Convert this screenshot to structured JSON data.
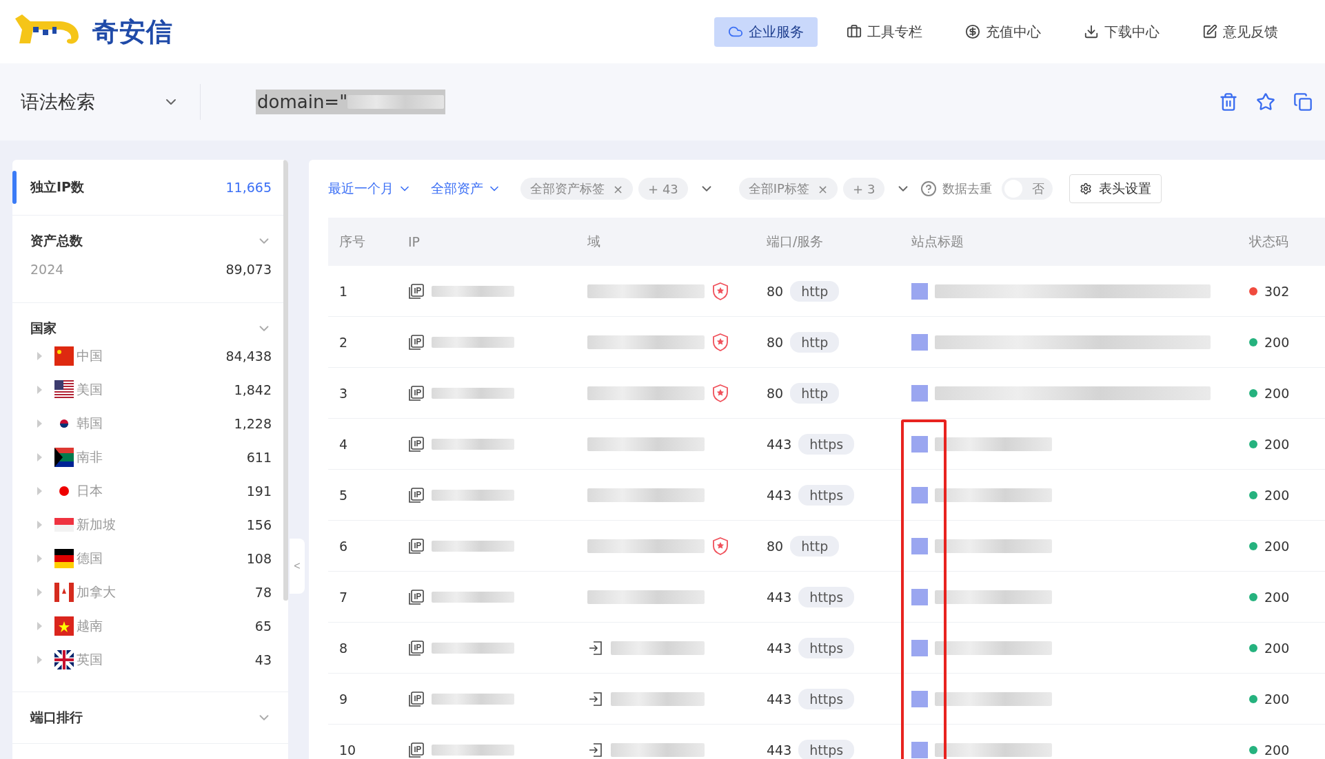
{
  "header": {
    "logo_text": "奇安信",
    "nav": [
      {
        "label": "企业服务",
        "selected": true
      },
      {
        "label": "工具专栏",
        "selected": false
      },
      {
        "label": "充值中心",
        "selected": false
      },
      {
        "label": "下载中心",
        "selected": false
      },
      {
        "label": "意见反馈",
        "selected": false
      }
    ]
  },
  "search": {
    "mode": "语法检索",
    "query": "domain=\""
  },
  "sidebar": {
    "sections": [
      {
        "kind": "single",
        "title": "独立IP数",
        "value": "11,665",
        "selected": true
      },
      {
        "kind": "list",
        "title": "资产总数",
        "expanded": true,
        "items": [
          {
            "label": "2024",
            "value": "89,073"
          }
        ]
      },
      {
        "kind": "countries",
        "title": "国家",
        "expanded": true,
        "items": [
          {
            "label": "中国",
            "value": "84,438",
            "kind": "cn"
          },
          {
            "label": "美国",
            "value": "1,842",
            "kind": "us"
          },
          {
            "label": "韩国",
            "value": "1,228",
            "kind": "kr"
          },
          {
            "label": "南非",
            "value": "611",
            "kind": "za"
          },
          {
            "label": "日本",
            "value": "191",
            "kind": "jp"
          },
          {
            "label": "新加坡",
            "value": "156",
            "kind": "sg"
          },
          {
            "label": "德国",
            "value": "108",
            "kind": "de"
          },
          {
            "label": "加拿大",
            "value": "78",
            "kind": "ca"
          },
          {
            "label": "越南",
            "value": "65",
            "kind": "vn"
          },
          {
            "label": "英国",
            "value": "43",
            "kind": "gb"
          }
        ]
      },
      {
        "kind": "list",
        "title": "端口排行",
        "expanded": true
      }
    ]
  },
  "collapse_handle": "<",
  "filters": {
    "time": "最近一个月",
    "assets": "全部资产",
    "asset_tag": {
      "label": "全部资产标签",
      "remove": "×",
      "more": "+ 43"
    },
    "ip_tag": {
      "label": "全部IP标签",
      "remove": "×",
      "more": "+ 3"
    },
    "dedupe": {
      "label": "数据去重",
      "on": false,
      "state_text": "否"
    },
    "columns_button": "表头设置"
  },
  "table": {
    "columns": [
      "序号",
      "IP",
      "域",
      "端口/服务",
      "站点标题",
      "状态码"
    ],
    "rows": [
      {
        "index": "1",
        "kind": "shield",
        "port": "80",
        "service": "http",
        "status": "302",
        "color": "#f04b3e"
      },
      {
        "index": "2",
        "kind": "shield",
        "port": "80",
        "service": "http",
        "status": "200",
        "color": "#25b27e"
      },
      {
        "index": "3",
        "kind": "shield",
        "port": "80",
        "service": "http",
        "status": "200",
        "color": "#25b27e"
      },
      {
        "index": "4",
        "kind": "plain",
        "port": "443",
        "service": "https",
        "status": "200",
        "color": "#25b27e"
      },
      {
        "index": "5",
        "kind": "plain",
        "port": "443",
        "service": "https",
        "status": "200",
        "color": "#25b27e"
      },
      {
        "index": "6",
        "kind": "shield",
        "port": "80",
        "service": "http",
        "status": "200",
        "color": "#25b27e"
      },
      {
        "index": "7",
        "kind": "plain",
        "port": "443",
        "service": "https",
        "status": "200",
        "color": "#25b27e"
      },
      {
        "index": "8",
        "kind": "login",
        "port": "443",
        "service": "https",
        "status": "200",
        "color": "#25b27e"
      },
      {
        "index": "9",
        "kind": "login",
        "port": "443",
        "service": "https",
        "status": "200",
        "color": "#25b27e"
      },
      {
        "index": "10",
        "kind": "login",
        "port": "443",
        "service": "https",
        "status": "200",
        "color": "#25b27e"
      }
    ]
  }
}
